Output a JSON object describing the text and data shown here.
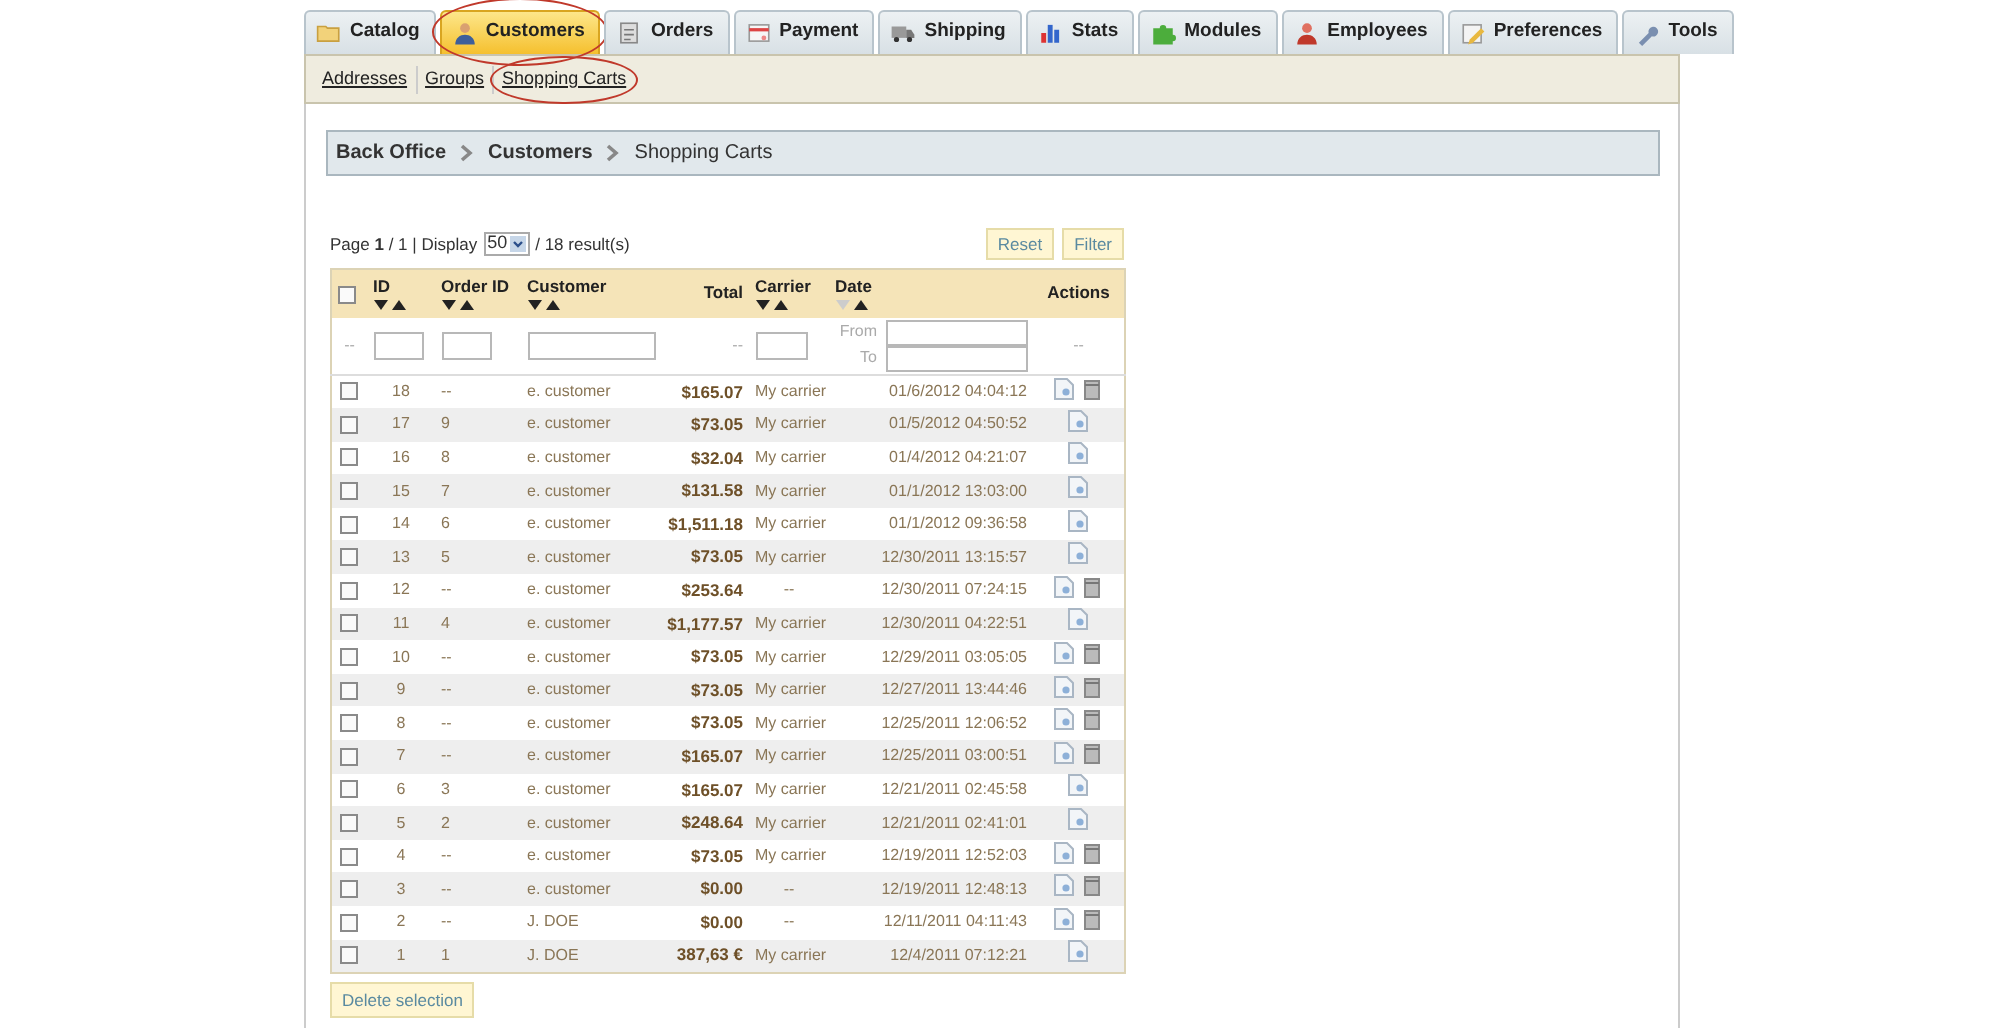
{
  "tabs": [
    {
      "label": "Catalog",
      "selected": false,
      "circled": false
    },
    {
      "label": "Customers",
      "selected": true,
      "circled": true
    },
    {
      "label": "Orders",
      "selected": false,
      "circled": false
    },
    {
      "label": "Payment",
      "selected": false,
      "circled": false
    },
    {
      "label": "Shipping",
      "selected": false,
      "circled": false
    },
    {
      "label": "Stats",
      "selected": false,
      "circled": false
    },
    {
      "label": "Modules",
      "selected": false,
      "circled": false
    },
    {
      "label": "Employees",
      "selected": false,
      "circled": false
    },
    {
      "label": "Preferences",
      "selected": false,
      "circled": false
    },
    {
      "label": "Tools",
      "selected": false,
      "circled": false
    }
  ],
  "subnav": [
    {
      "label": "Addresses",
      "circled": false
    },
    {
      "label": "Groups",
      "circled": false
    },
    {
      "label": "Shopping Carts",
      "circled": true
    }
  ],
  "breadcrumb": [
    "Back Office",
    "Customers",
    "Shopping Carts"
  ],
  "pagination": {
    "text": "Page **1** / 1 | Display",
    "display": "50",
    "results": "/ 18 result(s)"
  },
  "filter_buttons": [
    "Reset",
    "Filter"
  ],
  "table": {
    "all_checked": false,
    "columns": [
      {
        "label": "ID",
        "sorted": false
      },
      {
        "label": "Order ID",
        "sorted": false
      },
      {
        "label": "Customer",
        "sorted": false
      },
      {
        "label": "Total"
      },
      {
        "label": "Carrier",
        "sorted": false
      },
      {
        "label": "Date",
        "sorted": true
      },
      {
        "label": "Actions"
      }
    ],
    "filters": {
      "empty": "--",
      "from": "From",
      "to": "To"
    },
    "rows": [
      {
        "id": "18",
        "order_id": "--",
        "customer": "e. customer",
        "total": "$165.07",
        "carrier": "My carrier",
        "date": "01/6/2012 04:04:12",
        "checked": false,
        "deletable": true
      },
      {
        "id": "17",
        "order_id": "9",
        "customer": "e. customer",
        "total": "$73.05",
        "carrier": "My carrier",
        "date": "01/5/2012 04:50:52",
        "checked": false,
        "deletable": false
      },
      {
        "id": "16",
        "order_id": "8",
        "customer": "e. customer",
        "total": "$32.04",
        "carrier": "My carrier",
        "date": "01/4/2012 04:21:07",
        "checked": false,
        "deletable": false
      },
      {
        "id": "15",
        "order_id": "7",
        "customer": "e. customer",
        "total": "$131.58",
        "carrier": "My carrier",
        "date": "01/1/2012 13:03:00",
        "checked": false,
        "deletable": false
      },
      {
        "id": "14",
        "order_id": "6",
        "customer": "e. customer",
        "total": "$1,511.18",
        "carrier": "My carrier",
        "date": "01/1/2012 09:36:58",
        "checked": false,
        "deletable": false
      },
      {
        "id": "13",
        "order_id": "5",
        "customer": "e. customer",
        "total": "$73.05",
        "carrier": "My carrier",
        "date": "12/30/2011 13:15:57",
        "checked": false,
        "deletable": false
      },
      {
        "id": "12",
        "order_id": "--",
        "customer": "e. customer",
        "total": "$253.64",
        "carrier": "--",
        "date": "12/30/2011 07:24:15",
        "checked": false,
        "deletable": true
      },
      {
        "id": "11",
        "order_id": "4",
        "customer": "e. customer",
        "total": "$1,177.57",
        "carrier": "My carrier",
        "date": "12/30/2011 04:22:51",
        "checked": false,
        "deletable": false
      },
      {
        "id": "10",
        "order_id": "--",
        "customer": "e. customer",
        "total": "$73.05",
        "carrier": "My carrier",
        "date": "12/29/2011 03:05:05",
        "checked": false,
        "deletable": true
      },
      {
        "id": "9",
        "order_id": "--",
        "customer": "e. customer",
        "total": "$73.05",
        "carrier": "My carrier",
        "date": "12/27/2011 13:44:46",
        "checked": false,
        "deletable": true
      },
      {
        "id": "8",
        "order_id": "--",
        "customer": "e. customer",
        "total": "$73.05",
        "carrier": "My carrier",
        "date": "12/25/2011 12:06:52",
        "checked": false,
        "deletable": true
      },
      {
        "id": "7",
        "order_id": "--",
        "customer": "e. customer",
        "total": "$165.07",
        "carrier": "My carrier",
        "date": "12/25/2011 03:00:51",
        "checked": false,
        "deletable": true
      },
      {
        "id": "6",
        "order_id": "3",
        "customer": "e. customer",
        "total": "$165.07",
        "carrier": "My carrier",
        "date": "12/21/2011 02:45:58",
        "checked": false,
        "deletable": false
      },
      {
        "id": "5",
        "order_id": "2",
        "customer": "e. customer",
        "total": "$248.64",
        "carrier": "My carrier",
        "date": "12/21/2011 02:41:01",
        "checked": false,
        "deletable": false
      },
      {
        "id": "4",
        "order_id": "--",
        "customer": "e. customer",
        "total": "$73.05",
        "carrier": "My carrier",
        "date": "12/19/2011 12:52:03",
        "checked": false,
        "deletable": true
      },
      {
        "id": "3",
        "order_id": "--",
        "customer": "e. customer",
        "total": "$0.00",
        "carrier": "--",
        "date": "12/19/2011 12:48:13",
        "checked": false,
        "deletable": true
      },
      {
        "id": "2",
        "order_id": "--",
        "customer": "J. DOE",
        "total": "$0.00",
        "carrier": "--",
        "date": "12/11/2011 04:11:43",
        "checked": false,
        "deletable": true
      },
      {
        "id": "1",
        "order_id": "1",
        "customer": "J. DOE",
        "total": "387,63 €",
        "carrier": "My carrier",
        "date": "12/4/2011 07:12:21",
        "checked": false,
        "deletable": false
      }
    ]
  },
  "bulk_button": "Delete selection"
}
